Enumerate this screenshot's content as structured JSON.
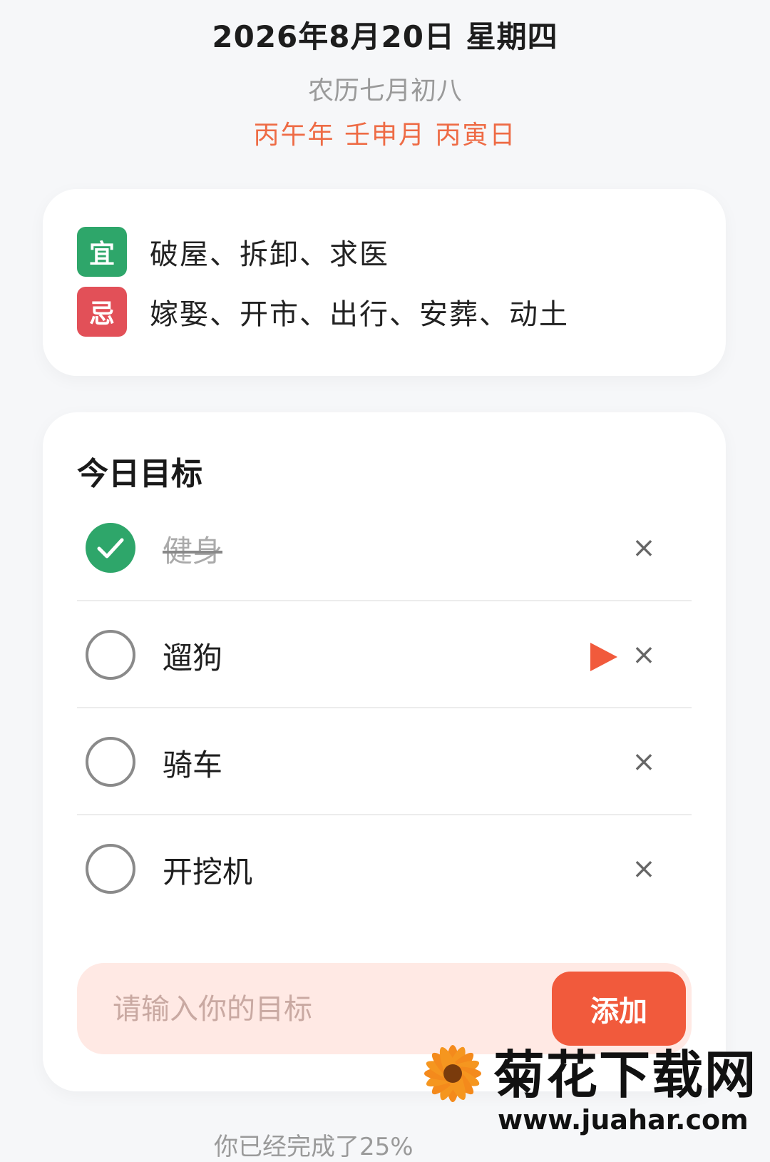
{
  "header": {
    "date": "2026年8月20日 星期四",
    "lunar": "农历七月初八",
    "ganzhi": "丙午年 壬申月 丙寅日"
  },
  "almanac": {
    "yi": {
      "badge": "宜",
      "items": "破屋、拆卸、求医",
      "color": "#2ea66a"
    },
    "ji": {
      "badge": "忌",
      "items": "嫁娶、开市、出行、安葬、动土",
      "color": "#e25058"
    }
  },
  "goals": {
    "title": "今日目标",
    "items": [
      {
        "label": "健身",
        "done": true
      },
      {
        "label": "遛狗",
        "done": false,
        "active": true
      },
      {
        "label": "骑车",
        "done": false
      },
      {
        "label": "开挖机",
        "done": false
      }
    ],
    "close_symbol": "×",
    "input_placeholder": "请输入你的目标",
    "add_label": "添加"
  },
  "footer": {
    "progress_text": "你已经完成了25%"
  },
  "watermark": {
    "title": "菊花下载网",
    "url": "www.juahar.com"
  },
  "colors": {
    "accent": "#f15a3c",
    "success": "#2ea66a",
    "danger": "#e25058"
  }
}
